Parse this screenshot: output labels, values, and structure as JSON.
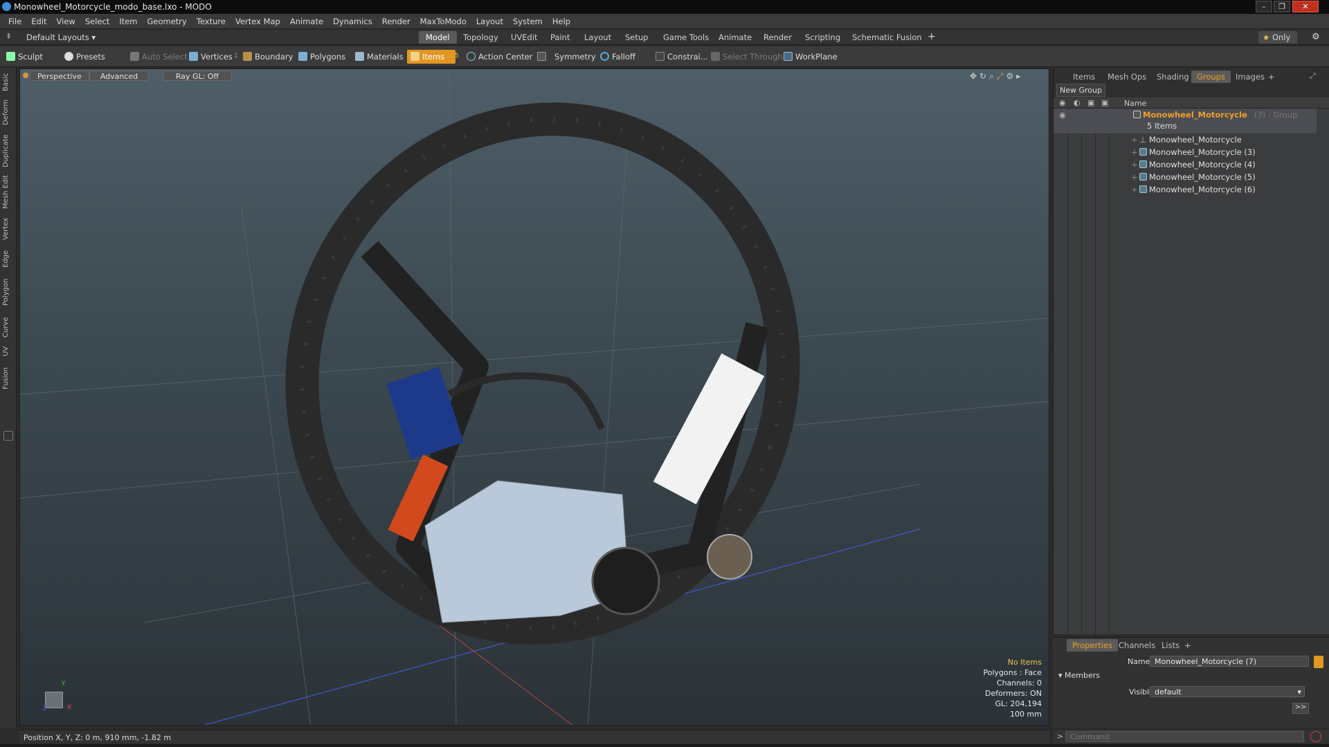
{
  "window": {
    "title": "Monowheel_Motorcycle_modo_base.lxo - MODO",
    "minimize": "–",
    "maximize": "❐",
    "close": "✕"
  },
  "menubar": [
    "File",
    "Edit",
    "View",
    "Select",
    "Item",
    "Geometry",
    "Texture",
    "Vertex Map",
    "Animate",
    "Dynamics",
    "Render",
    "MaxToModo",
    "Layout",
    "System",
    "Help"
  ],
  "layouts": {
    "label": "Default Layouts",
    "caret": "▾"
  },
  "tabs": {
    "active": "Model",
    "items": [
      "Model",
      "Topology",
      "UVEdit",
      "Paint",
      "Layout",
      "Setup",
      "Game Tools",
      "Animate",
      "Render",
      "Scripting",
      "Schematic Fusion"
    ],
    "add": "+",
    "only": "Only",
    "only_star": "★",
    "settings": "⚙"
  },
  "toolbar": {
    "sculpt": "Sculpt",
    "presets": "Presets",
    "auto_select": "Auto Select",
    "vertices": "Vertices",
    "vertices_count": "1",
    "boundary": "Boundary",
    "polygons": "Polygons",
    "materials": "Materials",
    "items": "Items",
    "items_count": "5",
    "action_center": "Action Center",
    "symmetry": "Symmetry",
    "falloff": "Falloff",
    "constraints": "Constrai...",
    "select_through": "Select Through",
    "workplane": "WorkPlane"
  },
  "left_tabs": [
    "Basic",
    "Deform",
    "Duplicate",
    "Mesh Edit",
    "Vertex",
    "Edge",
    "Polygon",
    "Curve",
    "UV",
    "Fusion"
  ],
  "viewport": {
    "view_mode": "Perspective",
    "advanced": "Advanced",
    "raygl": "Ray GL: Off",
    "stats": {
      "selection": "No Items",
      "polygons": "Polygons : Face",
      "channels": "Channels: 0",
      "deformers": "Deformers: ON",
      "gl": "GL: 204,194",
      "grid": "100 mm"
    },
    "axis_y": "Y",
    "axis_x": "X",
    "axis_z": "Z"
  },
  "status_bar": {
    "position": "Position X, Y, Z:  0 m, 910 mm, -1.82 m"
  },
  "right_panel": {
    "tabs": [
      "Items",
      "Mesh Ops",
      "Shading",
      "Groups",
      "Images"
    ],
    "active_tab": "Groups",
    "add_tab": "+",
    "new_group": "New Group",
    "column_name": "Name",
    "group": {
      "name": "Monowheel_Motorcycle",
      "suffix": "(7) : Group",
      "count": "5 Items"
    },
    "members": [
      "Monowheel_Motorcycle",
      "Monowheel_Motorcycle (3)",
      "Monowheel_Motorcycle (4)",
      "Monowheel_Motorcycle (5)",
      "Monowheel_Motorcycle (6)"
    ]
  },
  "properties": {
    "tabs": [
      "Properties",
      "Channels",
      "Lists"
    ],
    "active_tab": "Properties",
    "add_tab": "+",
    "name_label": "Name",
    "name_value": "Monowheel_Motorcycle (7)",
    "members_section": "Members",
    "visible_label": "Visible",
    "visible_value": "default",
    "more": ">>"
  },
  "command": {
    "placeholder": "Command",
    "prompt": ">"
  },
  "colors": {
    "accent": "#e29722",
    "group_name": "#f29f2a",
    "stats_highlight": "#f0c24a"
  }
}
